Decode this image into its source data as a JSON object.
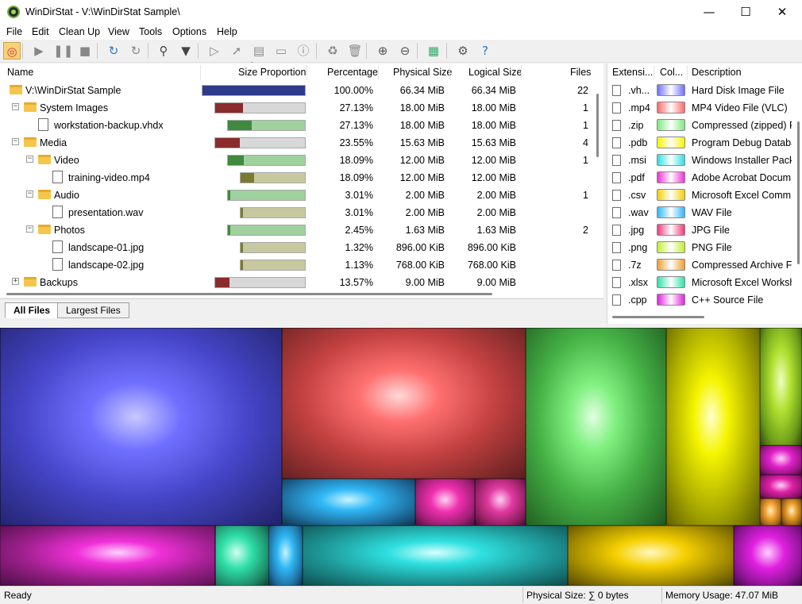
{
  "window": {
    "title": "WinDirStat - V:\\WinDirStat Sample\\",
    "minimize_glyph": "—",
    "maximize_glyph": "☐",
    "close_glyph": "✕"
  },
  "menu": [
    "File",
    "Edit",
    "Clean Up",
    "View",
    "Tools",
    "Options",
    "Help"
  ],
  "toolbar": [
    {
      "icon": "target-icon",
      "glyph": "◎",
      "color": "#d33"
    },
    {
      "icon": "play-icon",
      "glyph": "▶",
      "color": "#888"
    },
    {
      "icon": "pause-icon",
      "glyph": "❚❚",
      "color": "#888"
    },
    {
      "icon": "stop-icon",
      "glyph": "■",
      "color": "#888"
    },
    {
      "icon": "refresh-icon",
      "glyph": "↻",
      "color": "#2a78c8"
    },
    {
      "icon": "refresh-selected-icon",
      "glyph": "↻",
      "color": "#888"
    },
    {
      "icon": "find-icon",
      "glyph": "⚲",
      "color": "#444"
    },
    {
      "icon": "filter-icon",
      "glyph": "▼",
      "color": "#444"
    },
    {
      "icon": "open-item-icon",
      "glyph": "▷",
      "color": "#888"
    },
    {
      "icon": "select-in-explorer-icon",
      "glyph": "➚",
      "color": "#888"
    },
    {
      "icon": "copy-path-icon",
      "glyph": "▤",
      "color": "#888"
    },
    {
      "icon": "command-prompt-icon",
      "glyph": "▭",
      "color": "#888"
    },
    {
      "icon": "properties-icon",
      "glyph": "ⓘ",
      "color": "#888"
    },
    {
      "icon": "recycle-icon",
      "glyph": "♻",
      "color": "#888"
    },
    {
      "icon": "delete-icon",
      "glyph": "🗑",
      "color": "#888"
    },
    {
      "icon": "zoom-in-icon",
      "glyph": "⊕",
      "color": "#555"
    },
    {
      "icon": "zoom-out-icon",
      "glyph": "⊖",
      "color": "#555"
    },
    {
      "icon": "treemap-toggle-icon",
      "glyph": "▦",
      "color": "#3a6"
    },
    {
      "icon": "settings-icon",
      "glyph": "⚙",
      "color": "#555"
    },
    {
      "icon": "help-icon",
      "glyph": "?",
      "color": "#2a78c8"
    }
  ],
  "tree": {
    "columns": [
      "Name",
      "Size Proportion",
      "Percentage",
      "Physical Size",
      "Logical Size",
      "Files"
    ],
    "rows": [
      {
        "name": "V:\\WinDirStat Sample",
        "type": "folder",
        "level": 0,
        "expander": "",
        "percentage": "100.00%",
        "physical": "66.34 MiB",
        "logical": "66.34 MiB",
        "files": "22",
        "proportion": 1.0,
        "bar_color": "#2e3a8c"
      },
      {
        "name": "System Images",
        "type": "folder",
        "level": 1,
        "expander": "−",
        "percentage": "27.13%",
        "physical": "18.00 MiB",
        "logical": "18.00 MiB",
        "files": "1",
        "proportion": 0.2713,
        "bar_color": "#8a2c2c"
      },
      {
        "name": "workstation-backup.vhdx",
        "type": "file",
        "level": 2,
        "expander": "",
        "percentage": "27.13%",
        "physical": "18.00 MiB",
        "logical": "18.00 MiB",
        "files": "1",
        "proportion": 0.2713,
        "bar_color": "#3f8a3f",
        "bar_bg": "#9fd19f"
      },
      {
        "name": "Media",
        "type": "folder",
        "level": 1,
        "expander": "−",
        "percentage": "23.55%",
        "physical": "15.63 MiB",
        "logical": "15.63 MiB",
        "files": "4",
        "proportion": 0.2355,
        "bar_color": "#8a2c2c"
      },
      {
        "name": "Video",
        "type": "folder",
        "level": 2,
        "expander": "−",
        "percentage": "18.09%",
        "physical": "12.00 MiB",
        "logical": "12.00 MiB",
        "files": "1",
        "proportion": 0.1809,
        "bar_color": "#3f8a3f",
        "bar_bg": "#9fd19f"
      },
      {
        "name": "training-video.mp4",
        "type": "file",
        "level": 3,
        "expander": "",
        "percentage": "18.09%",
        "physical": "12.00 MiB",
        "logical": "12.00 MiB",
        "files": "",
        "proportion": 0.1809,
        "bar_color": "#7a7a30",
        "bar_bg": "#c8c8a0"
      },
      {
        "name": "Audio",
        "type": "folder",
        "level": 2,
        "expander": "−",
        "percentage": "3.01%",
        "physical": "2.00 MiB",
        "logical": "2.00 MiB",
        "files": "1",
        "proportion": 0.0301,
        "bar_color": "#3f8a3f",
        "bar_bg": "#9fd19f"
      },
      {
        "name": "presentation.wav",
        "type": "file",
        "level": 3,
        "expander": "",
        "percentage": "3.01%",
        "physical": "2.00 MiB",
        "logical": "2.00 MiB",
        "files": "",
        "proportion": 0.0301,
        "bar_color": "#7a7a30",
        "bar_bg": "#c8c8a0"
      },
      {
        "name": "Photos",
        "type": "folder",
        "level": 2,
        "expander": "−",
        "percentage": "2.45%",
        "physical": "1.63 MiB",
        "logical": "1.63 MiB",
        "files": "2",
        "proportion": 0.0245,
        "bar_color": "#3f8a3f",
        "bar_bg": "#9fd19f"
      },
      {
        "name": "landscape-01.jpg",
        "type": "file",
        "level": 3,
        "expander": "",
        "percentage": "1.32%",
        "physical": "896.00 KiB",
        "logical": "896.00 KiB",
        "files": "",
        "proportion": 0.0132,
        "bar_color": "#7a7a30",
        "bar_bg": "#c8c8a0"
      },
      {
        "name": "landscape-02.jpg",
        "type": "file",
        "level": 3,
        "expander": "",
        "percentage": "1.13%",
        "physical": "768.00 KiB",
        "logical": "768.00 KiB",
        "files": "",
        "proportion": 0.0113,
        "bar_color": "#7a7a30",
        "bar_bg": "#c8c8a0"
      },
      {
        "name": "Backups",
        "type": "folder",
        "level": 1,
        "expander": "+",
        "percentage": "13.57%",
        "physical": "9.00 MiB",
        "logical": "9.00 MiB",
        "files": "",
        "proportion": 0.1357,
        "bar_color": "#8a2c2c"
      }
    ]
  },
  "tabs": [
    "All Files",
    "Largest Files"
  ],
  "extensions": {
    "columns": [
      "Extensi...",
      "Col...",
      "Description"
    ],
    "rows": [
      {
        "ext": ".vh...",
        "color": "#7070ff",
        "description": "Hard Disk Image File"
      },
      {
        "ext": ".mp4",
        "color": "#ff6a6a",
        "description": "MP4 Video File (VLC)"
      },
      {
        "ext": ".zip",
        "color": "#7fe87f",
        "description": "Compressed (zipped) F"
      },
      {
        "ext": ".pdb",
        "color": "#f5f500",
        "description": "Program Debug Databa"
      },
      {
        "ext": ".msi",
        "color": "#2fe0e0",
        "description": "Windows Installer Pack"
      },
      {
        "ext": ".pdf",
        "color": "#f030d8",
        "description": "Adobe Acrobat Docum"
      },
      {
        "ext": ".csv",
        "color": "#f5d000",
        "description": "Microsoft Excel Comm"
      },
      {
        "ext": ".wav",
        "color": "#30b8f5",
        "description": "WAV File"
      },
      {
        "ext": ".jpg",
        "color": "#f03a7a",
        "description": "JPG File"
      },
      {
        "ext": ".png",
        "color": "#c0f030",
        "description": "PNG File"
      },
      {
        "ext": ".7z",
        "color": "#f0a030",
        "description": "Compressed Archive Fo"
      },
      {
        "ext": ".xlsx",
        "color": "#30e0a8",
        "description": "Microsoft Excel Worksh"
      },
      {
        "ext": ".cpp",
        "color": "#e020e0",
        "description": "C++ Source File"
      }
    ]
  },
  "status": {
    "ready": "Ready",
    "physical": "Physical Size: ∑ 0 bytes",
    "memory": "Memory Usage: 47.07 MiB"
  }
}
